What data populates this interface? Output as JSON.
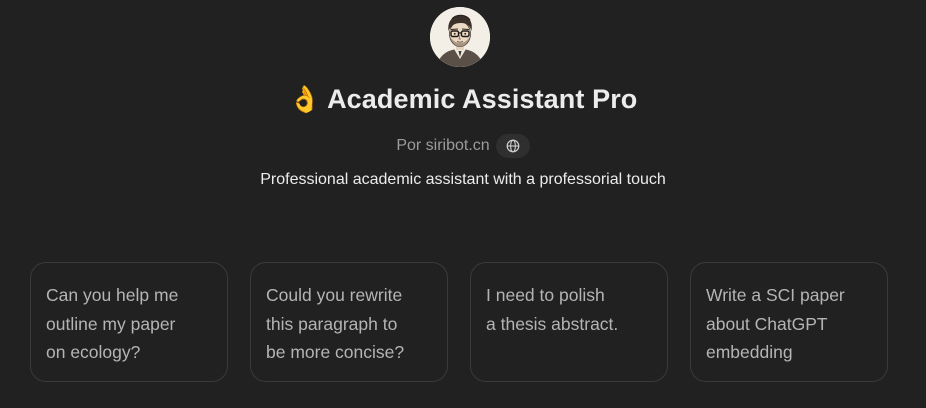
{
  "header": {
    "avatar_icon": "professor-portrait-avatar",
    "title_emoji": "👌",
    "title": "Academic Assistant Pro",
    "byline": "Por siribot.cn",
    "byline_icon": "globe-icon",
    "description": "Professional academic assistant with a professorial touch"
  },
  "starters": [
    {
      "lines": [
        "Can you help me",
        "outline my paper",
        "on ecology?"
      ]
    },
    {
      "lines": [
        "Could you rewrite",
        "this paragraph to",
        "be more concise?"
      ]
    },
    {
      "lines": [
        "I need to polish",
        "a thesis abstract."
      ]
    },
    {
      "lines": [
        "Write a SCI paper",
        "about ChatGPT",
        "embedding"
      ]
    }
  ],
  "colors": {
    "background": "#212121",
    "card_border": "#3a3a3a",
    "muted_text": "#9b9b9b",
    "card_text": "#b4b4b4"
  }
}
